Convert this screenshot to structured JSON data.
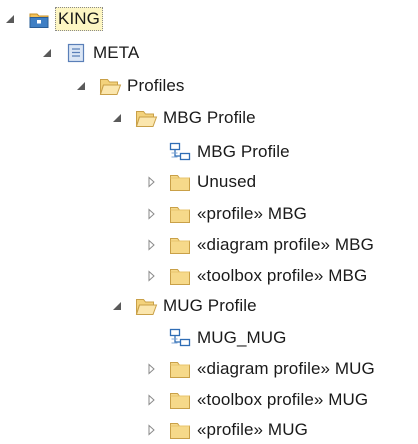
{
  "tree": {
    "root": {
      "label": "KING",
      "icon": "package-root-icon",
      "expanded": true,
      "selected": true
    },
    "meta": {
      "label": "META",
      "icon": "model-icon",
      "expanded": true
    },
    "profiles": {
      "label": "Profiles",
      "icon": "open-folder-icon",
      "expanded": true
    },
    "mbg_profile": {
      "label": "MBG Profile",
      "icon": "open-folder-icon",
      "expanded": true
    },
    "mbg_profile_diagram": {
      "label": "MBG Profile",
      "icon": "diagram-icon"
    },
    "unused": {
      "label": "Unused",
      "icon": "folder-icon",
      "expanded": false
    },
    "profile_mbg": {
      "label": "«profile» MBG",
      "icon": "folder-icon",
      "expanded": false
    },
    "diagram_profile_mbg": {
      "label": "«diagram profile» MBG",
      "icon": "folder-icon",
      "expanded": false
    },
    "toolbox_profile_mbg": {
      "label": "«toolbox profile» MBG",
      "icon": "folder-icon",
      "expanded": false
    },
    "mug_profile": {
      "label": "MUG Profile",
      "icon": "open-folder-icon",
      "expanded": true
    },
    "mug_mug_diagram": {
      "label": "MUG_MUG",
      "icon": "diagram-icon"
    },
    "diagram_profile_mug": {
      "label": "«diagram profile» MUG",
      "icon": "folder-icon",
      "expanded": false
    },
    "toolbox_profile_mug": {
      "label": "«toolbox profile» MUG",
      "icon": "folder-icon",
      "expanded": false
    },
    "profile_mug": {
      "label": "«profile» MUG",
      "icon": "folder-icon",
      "expanded": false
    }
  },
  "colors": {
    "folder_fill": "#f6d98a",
    "folder_stroke": "#c9a048",
    "selection_bg": "#fdf6c3",
    "diagram_blue": "#2f6db5",
    "model_blue": "#5a7fb8"
  }
}
